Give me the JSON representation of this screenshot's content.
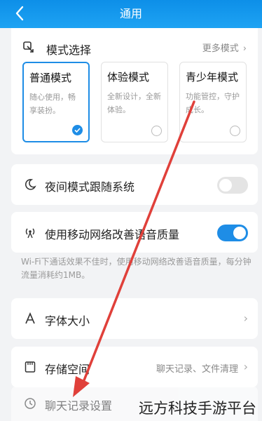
{
  "header": {
    "title": "通用"
  },
  "mode_section": {
    "title": "模式选择",
    "more_label": "更多模式",
    "options": [
      {
        "name": "普通模式",
        "desc": "随心使用，畅享装扮。",
        "selected": true
      },
      {
        "name": "体验模式",
        "desc": "全新设计，全新体验。",
        "selected": false
      },
      {
        "name": "青少年模式",
        "desc": "功能管控，守护成长。",
        "selected": false
      }
    ]
  },
  "night_mode": {
    "label": "夜间模式跟随系统",
    "enabled": false
  },
  "mobile_network": {
    "label": "使用移动网络改善语音质量",
    "enabled": true
  },
  "network_hint": "Wi-Fi下通话效果不佳时，使用移动网络改善语音质量，每分钟流量消耗约1MB。",
  "font_size": {
    "label": "字体大小"
  },
  "storage": {
    "label": "存储空间",
    "detail": "聊天记录、文件清理"
  },
  "chat_history": {
    "label": "聊天记录设置"
  },
  "watermark": "远方科技手游平台",
  "colors": {
    "accent": "#1e8de6",
    "header": "#1a9cf0",
    "arrow": "#e0403a"
  }
}
